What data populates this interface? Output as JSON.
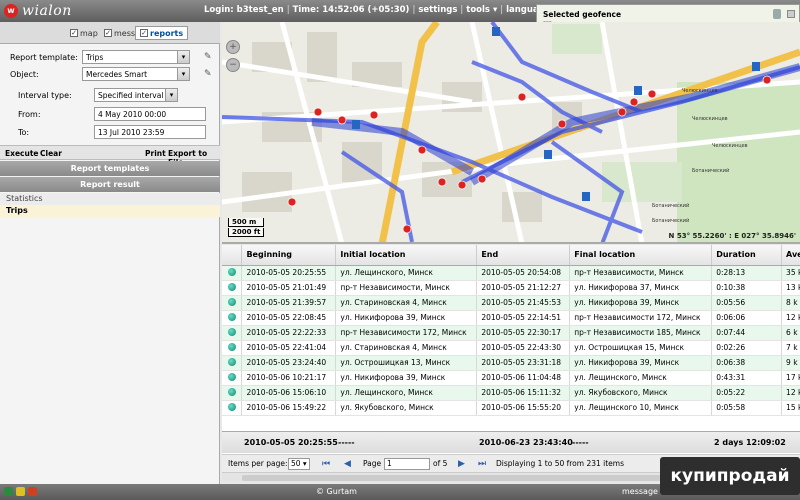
{
  "header": {
    "logo_text": "wialon",
    "login": "Login: b3test_en",
    "time": "Time: 14:52:06 (+05:30)",
    "menu": [
      "settings",
      "tools ▾",
      "language ▾"
    ]
  },
  "geofence_panel": {
    "title": "Selected geofence",
    "value": "---"
  },
  "tabs": [
    {
      "label": "map",
      "checked": true,
      "active": false
    },
    {
      "label": "messages",
      "checked": true,
      "active": false
    },
    {
      "label": "reports",
      "checked": true,
      "active": true
    }
  ],
  "report_form": {
    "template_label": "Report template:",
    "template_value": "Trips",
    "object_label": "Object:",
    "object_value": "Mercedes Smart",
    "interval_label": "Interval type:",
    "interval_value": "Specified interval",
    "from_label": "From:",
    "from_value": "4 May 2010 00:00",
    "to_label": "To:",
    "to_value": "13 Jul 2010 23:59"
  },
  "actions": {
    "execute": "Execute",
    "clear": "Clear",
    "print": "Print",
    "export": "Export to File"
  },
  "sections": {
    "templates": "Report templates",
    "result": "Report result"
  },
  "result_items": [
    "Statistics",
    "Trips"
  ],
  "map": {
    "scale_m": "500 m",
    "scale_ft": "2000 ft",
    "coords": "N 53° 55.2260' : E 027° 35.8946'",
    "place_labels": [
      "Челюскинцев",
      "Ботанический"
    ]
  },
  "table": {
    "columns": [
      "",
      "Beginning",
      "Initial location",
      "End",
      "Final location",
      "Duration",
      "Ave"
    ],
    "rows": [
      [
        "2010-05-05 20:25:55",
        "ул. Лещинского, Минск",
        "2010-05-05 20:54:08",
        "пр-т Независимости, Минск",
        "0:28:13",
        "35 k"
      ],
      [
        "2010-05-05 21:01:49",
        "пр-т Независимости, Минск",
        "2010-05-05 21:12:27",
        "ул. Никифорова 37, Минск",
        "0:10:38",
        "13 k"
      ],
      [
        "2010-05-05 21:39:57",
        "ул. Стариновская 4, Минск",
        "2010-05-05 21:45:53",
        "ул. Никифорова 39, Минск",
        "0:05:56",
        "8 k"
      ],
      [
        "2010-05-05 22:08:45",
        "ул. Никифорова 39, Минск",
        "2010-05-05 22:14:51",
        "пр-т Независимости 172, Минск",
        "0:06:06",
        "12 k"
      ],
      [
        "2010-05-05 22:22:33",
        "пр-т Независимости 172, Минск",
        "2010-05-05 22:30:17",
        "пр-т Независимости 185, Минск",
        "0:07:44",
        "6 k"
      ],
      [
        "2010-05-05 22:41:04",
        "ул. Стариновская 4, Минск",
        "2010-05-05 22:43:30",
        "ул. Острошицкая 15, Минск",
        "0:02:26",
        "7 k"
      ],
      [
        "2010-05-05 23:24:40",
        "ул. Острошицкая 13, Минск",
        "2010-05-05 23:31:18",
        "ул. Никифорова 39, Минск",
        "0:06:38",
        "9 k"
      ],
      [
        "2010-05-06 10:21:17",
        "ул. Никифорова 39, Минск",
        "2010-05-06 11:04:48",
        "ул. Лещинского, Минск",
        "0:43:31",
        "17 k"
      ],
      [
        "2010-05-06 15:06:10",
        "ул. Лещинского, Минск",
        "2010-05-06 15:11:32",
        "ул. Якубовского, Минск",
        "0:05:22",
        "12 k"
      ],
      [
        "2010-05-06 15:49:22",
        "ул. Якубовского, Минск",
        "2010-05-06 15:55:20",
        "ул. Лещинского 10, Минск",
        "0:05:58",
        "15 k"
      ]
    ]
  },
  "total": {
    "beginning": "2010-05-05 20:25:55",
    "initial": "-----",
    "end": "2010-06-23 23:43:40",
    "final": "-----",
    "duration": "2 days 12:09:02"
  },
  "pager": {
    "items_label": "Items per page:",
    "items_value": "50",
    "page_label": "Page",
    "page_value": "1",
    "of_label": "of 5",
    "summary": "Displaying 1 to 50 from 231 items"
  },
  "status": {
    "copyright": "© Gurtam",
    "messages": "message"
  },
  "watermark": "купипродай"
}
